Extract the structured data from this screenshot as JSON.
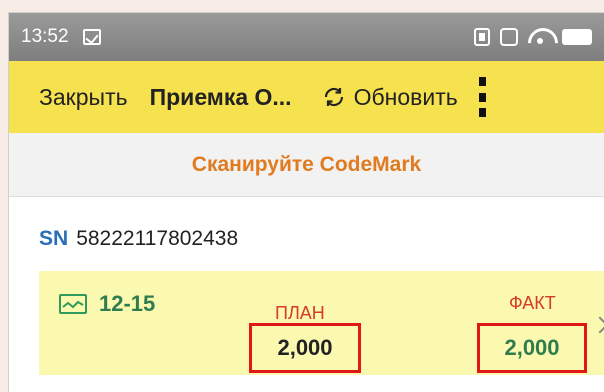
{
  "status_bar": {
    "time": "13:52",
    "icons": [
      "notification-check-icon",
      "sim-icon",
      "nfc-icon",
      "wifi-icon",
      "battery-icon"
    ]
  },
  "toolbar": {
    "close_label": "Закрыть",
    "title": "Приемка О...",
    "refresh_label": "Обновить",
    "background_color": "#f6e24e"
  },
  "banner": {
    "text": "Сканируйте CodeMark",
    "color": "#e07b1f"
  },
  "serial": {
    "prefix": "SN",
    "number": "58222117802438"
  },
  "item": {
    "range": "12-15",
    "plan_label": "ПЛАН",
    "plan_value": "2,000",
    "fact_label": "ФАКТ",
    "fact_value": "2,000",
    "highlight_color": "#e01818"
  }
}
